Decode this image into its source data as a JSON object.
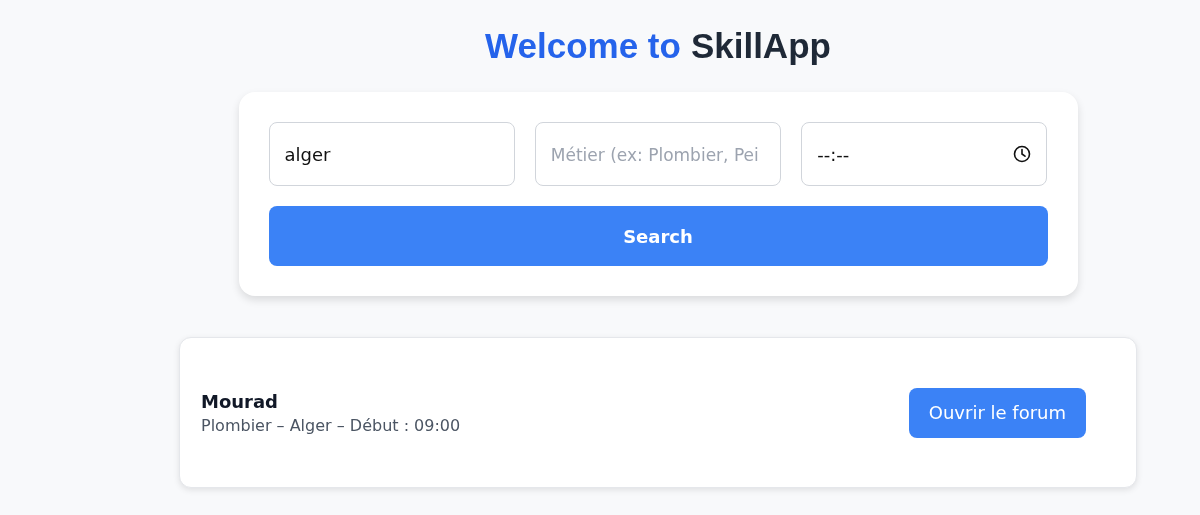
{
  "heading": {
    "lead": "Welcome to",
    "brand": "SkillApp"
  },
  "search": {
    "location": {
      "value": "alger"
    },
    "trade": {
      "placeholder": "Métier (ex: Plombier, Pei"
    },
    "time": {
      "value": "--:--"
    },
    "button": "Search"
  },
  "results": [
    {
      "name": "Mourad",
      "details": "Plombier – Alger – Début : 09:00",
      "action": "Ouvrir le forum"
    }
  ]
}
